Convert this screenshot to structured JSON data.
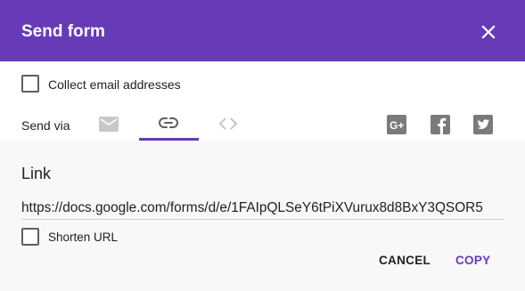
{
  "dialog": {
    "title": "Send form",
    "close_icon": "close-icon"
  },
  "collect_email": {
    "label": "Collect email addresses",
    "checked": false
  },
  "send_via": {
    "label": "Send via",
    "tabs": [
      {
        "icon": "email-icon",
        "selected": false
      },
      {
        "icon": "link-icon",
        "selected": true
      },
      {
        "icon": "embed-code-icon",
        "selected": false
      }
    ],
    "social": [
      {
        "icon": "google-plus-icon"
      },
      {
        "icon": "facebook-icon"
      },
      {
        "icon": "twitter-icon"
      }
    ]
  },
  "link": {
    "title": "Link",
    "url": "https://docs.google.com/forms/d/e/1FAIpQLSeY6tPiXVurux8d8BxY3QSOR5",
    "shorten_label": "Shorten URL",
    "shorten_checked": false
  },
  "actions": {
    "cancel_label": "CANCEL",
    "copy_label": "COPY"
  },
  "colors": {
    "accent": "#673ab7",
    "social_icon": "#7a7a7a",
    "panel_bg": "#f8f8f8"
  }
}
